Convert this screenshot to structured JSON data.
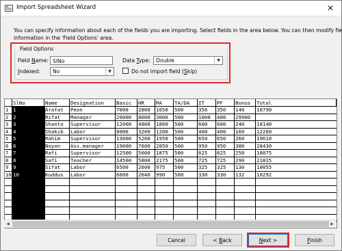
{
  "window": {
    "title": "Import Spreadsheet Wizard",
    "close_glyph": "✕"
  },
  "description": {
    "line1": "You can specify information about each of the fields you are importing. Select fields in the area below. You can then modify field",
    "line2": "information in the 'Field Options' area."
  },
  "field_options": {
    "legend": "Field Options",
    "field_name_label_pre": "Field ",
    "field_name_label_ul": "N",
    "field_name_label_post": "ame:",
    "field_name_value": "SlNo",
    "data_type_label_pre": "Data ",
    "data_type_label_ul": "T",
    "data_type_label_post": "ype:",
    "data_type_value": "Double",
    "indexed_label_pre": "",
    "indexed_label_ul": "I",
    "indexed_label_post": "ndexed:",
    "indexed_value": "No",
    "skip_label_pre": "Do not import field (",
    "skip_label_ul": "S",
    "skip_label_post": "kip)",
    "skip_checked": false
  },
  "grid": {
    "columns": [
      "SlNo",
      "Name",
      "Designation",
      "Basic",
      "HR",
      "MA",
      "TA/DA",
      "IT",
      "PF",
      "Bonus",
      "Total"
    ],
    "row_numbers": [
      "1",
      "2",
      "3",
      "4",
      "5",
      "6",
      "7",
      "8",
      "9",
      "10"
    ],
    "rows": [
      [
        "1",
        "Arafat",
        "Peon",
        "7000",
        "2800",
        "1050",
        "500",
        "350",
        "350",
        "140",
        "10790"
      ],
      [
        "2",
        "Rifat",
        "Manager",
        "20000",
        "8000",
        "3000",
        "500",
        "1000",
        "400",
        "29900"
      ],
      [
        "3",
        "Shanto",
        "Supervisor",
        "12000",
        "4800",
        "1800",
        "500",
        "600",
        "600",
        "240",
        "18140"
      ],
      [
        "4",
        "Shakib",
        "Labor",
        "8000",
        "3200",
        "1200",
        "500",
        "400",
        "400",
        "160",
        "12260"
      ],
      [
        "5",
        "Rahim",
        "Supervisor",
        "13000",
        "5200",
        "1950",
        "500",
        "650",
        "650",
        "260",
        "19610"
      ],
      [
        "6",
        "Noyon",
        "Ass.manager",
        "19000",
        "7600",
        "2850",
        "500",
        "950",
        "950",
        "380",
        "28430"
      ],
      [
        "7",
        "Rafi",
        "Supervisor",
        "12500",
        "5000",
        "1875",
        "500",
        "625",
        "625",
        "250",
        "18875"
      ],
      [
        "8",
        "Safi",
        "Teacher",
        "14500",
        "5800",
        "2175",
        "500",
        "725",
        "725",
        "290",
        "21815"
      ],
      [
        "9",
        "Sifat",
        "Labor",
        "6500",
        "2600",
        "975",
        "500",
        "325",
        "325",
        "130",
        "10055"
      ],
      [
        "10",
        "Kuddus",
        "Labor",
        "6600",
        "2640",
        "990",
        "500",
        "330",
        "330",
        "132",
        "10292"
      ]
    ]
  },
  "buttons": {
    "cancel": "Cancel",
    "back_pre": "< ",
    "back_ul": "B",
    "back_post": "ack",
    "next_pre": "",
    "next_ul": "N",
    "next_post": "ext >",
    "finish_pre": "",
    "finish_ul": "F",
    "finish_post": "inish"
  },
  "colors": {
    "highlight_red": "#e0272f",
    "selected_column": "#000000"
  }
}
